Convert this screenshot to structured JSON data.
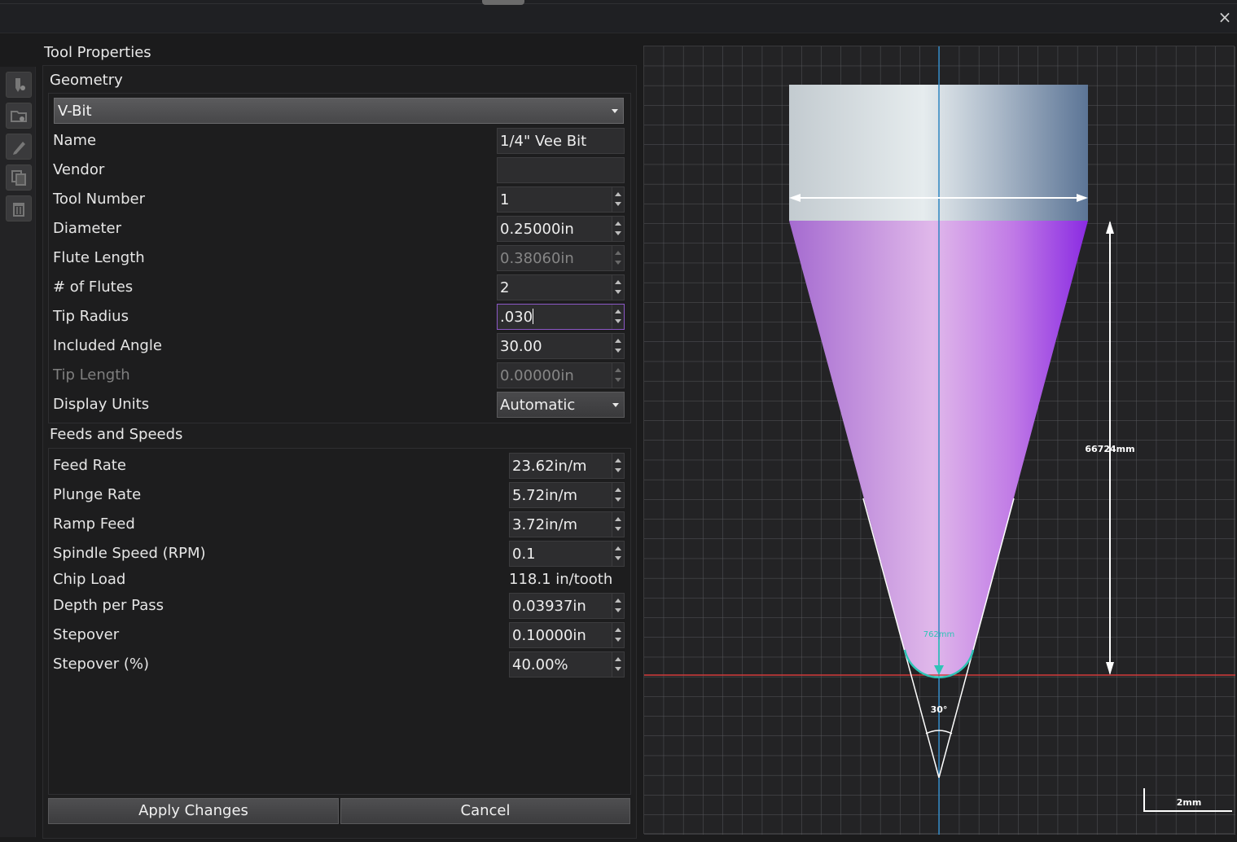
{
  "window": {
    "close_icon": "×"
  },
  "sidebar": {
    "icons": [
      "tool-icon",
      "folder-icon",
      "pencil-icon",
      "copy-icon",
      "trash-icon"
    ]
  },
  "panel": {
    "title": "Tool Properties",
    "geometry": {
      "title": "Geometry",
      "tool_type": "V-Bit",
      "rows": {
        "name": {
          "label": "Name",
          "value": "1/4\" Vee Bit"
        },
        "vendor": {
          "label": "Vendor",
          "value": ""
        },
        "tool_number": {
          "label": "Tool Number",
          "value": "1"
        },
        "diameter": {
          "label": "Diameter",
          "value": "0.25000in"
        },
        "flute_length": {
          "label": "Flute Length",
          "value": "0.38060in"
        },
        "num_flutes": {
          "label": "# of Flutes",
          "value": "2"
        },
        "tip_radius": {
          "label": "Tip Radius",
          "value": ".030"
        },
        "included_angle": {
          "label": "Included Angle",
          "value": "30.00"
        },
        "tip_length": {
          "label": "Tip Length",
          "value": "0.00000in"
        },
        "display_units": {
          "label": "Display Units",
          "value": "Automatic"
        }
      }
    },
    "feeds": {
      "title": "Feeds and Speeds",
      "rows": {
        "feed_rate": {
          "label": "Feed Rate",
          "value": "23.62in/m"
        },
        "plunge_rate": {
          "label": "Plunge Rate",
          "value": "5.72in/m"
        },
        "ramp_feed": {
          "label": "Ramp Feed",
          "value": "3.72in/m"
        },
        "spindle_speed": {
          "label": "Spindle Speed (RPM)",
          "value": "0.1"
        },
        "chip_load": {
          "label": "Chip Load",
          "value": "118.1 in/tooth"
        },
        "depth_per_pass": {
          "label": "Depth per Pass",
          "value": "0.03937in"
        },
        "stepover": {
          "label": "Stepover",
          "value": "0.10000in"
        },
        "stepover_pct": {
          "label": "Stepover (%)",
          "value": "40.00%"
        }
      }
    },
    "buttons": {
      "apply": "Apply Changes",
      "cancel": "Cancel"
    }
  },
  "preview": {
    "length_label": "66724mm",
    "tip_radius_label": "762mm",
    "angle_label": "30°",
    "scale_label": "2mm",
    "colors": {
      "shank": "#c9d2d8",
      "flute": "#c07ae6",
      "accent": "#8c58c6",
      "axis": "#2e86c1",
      "baseline": "#d23a3a",
      "tip": "#2ec4b6"
    }
  }
}
